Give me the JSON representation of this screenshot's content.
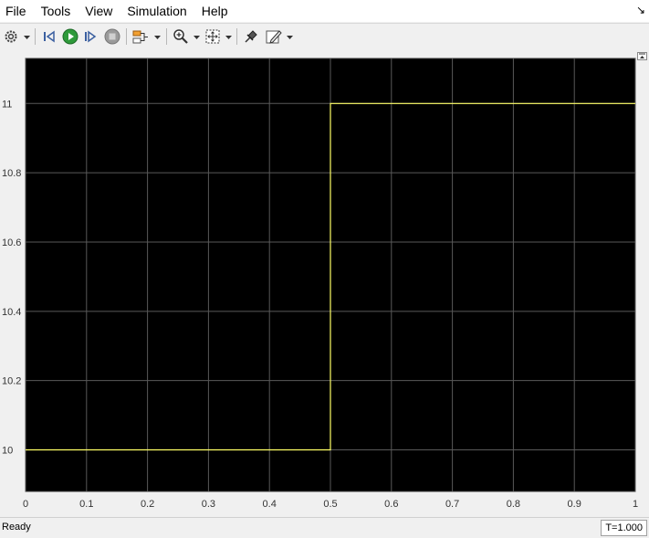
{
  "menu": {
    "items": [
      "File",
      "Tools",
      "View",
      "Simulation",
      "Help"
    ],
    "undock_icon": "undock-arrow-icon"
  },
  "toolbar": {
    "icons": [
      "gear-icon",
      "step-back-icon",
      "run-icon",
      "step-forward-icon",
      "stop-icon",
      "signal-selector-icon",
      "zoom-in-icon",
      "fit-to-view-icon",
      "pin-icon",
      "highlight-icon"
    ],
    "colors": {
      "run": "#2e9a3a",
      "stop": "#9a9a9a"
    }
  },
  "status": {
    "text": "Ready",
    "time": "T=1.000"
  },
  "chart_data": {
    "type": "line",
    "title": "",
    "xlabel": "",
    "ylabel": "",
    "xlim": [
      0,
      1
    ],
    "ylim": [
      9.88,
      11.13
    ],
    "xticks": [
      0,
      0.1,
      0.2,
      0.3,
      0.4,
      0.5,
      0.6,
      0.7,
      0.8,
      0.9,
      1
    ],
    "xtick_labels": [
      "0",
      "0.1",
      "0.2",
      "0.3",
      "0.4",
      "0.5",
      "0.6",
      "0.7",
      "0.8",
      "0.9",
      "1"
    ],
    "yticks": [
      10,
      10.2,
      10.4,
      10.6,
      10.8,
      11
    ],
    "ytick_labels": [
      "10",
      "10.2",
      "10.4",
      "10.6",
      "10.8",
      "11"
    ],
    "grid": true,
    "background": "#000000",
    "grid_color": "#595959",
    "series": [
      {
        "color": "#ffff66",
        "x": [
          0,
          0.5,
          0.5,
          1
        ],
        "y": [
          10,
          10,
          11,
          11
        ]
      }
    ]
  }
}
